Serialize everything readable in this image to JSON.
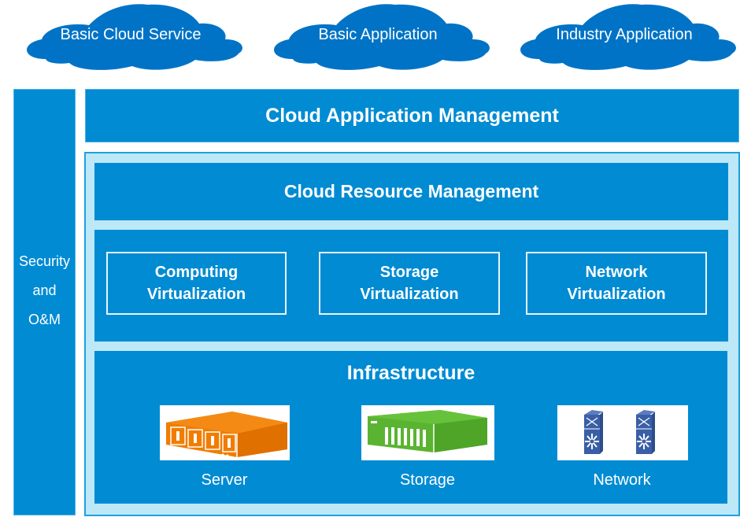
{
  "clouds": [
    {
      "label": "Basic Cloud Service"
    },
    {
      "label": "Basic Application"
    },
    {
      "label": "Industry Application"
    }
  ],
  "side_panel": {
    "lines": [
      "Security",
      "and",
      "O&M"
    ]
  },
  "layers": {
    "cloud_application_management": "Cloud Application Management",
    "cloud_resource_management": "Cloud Resource Management",
    "virtualization": [
      {
        "line1": "Computing",
        "line2": "Virtualization"
      },
      {
        "line1": "Storage",
        "line2": "Virtualization"
      },
      {
        "line1": "Network",
        "line2": "Virtualization"
      }
    ],
    "infrastructure": {
      "title": "Infrastructure",
      "devices": [
        {
          "label": "Server",
          "icon": "server-icon",
          "color": "#f07d00"
        },
        {
          "label": "Storage",
          "icon": "storage-array-icon",
          "color": "#5ab431"
        },
        {
          "label": "Network",
          "icon": "network-switch-icon",
          "color": "#3a5fa6"
        }
      ]
    }
  },
  "colors": {
    "primary_blue": "#008bd3",
    "cloud_blue": "#0073c6",
    "light_blue": "#bde8f8"
  }
}
